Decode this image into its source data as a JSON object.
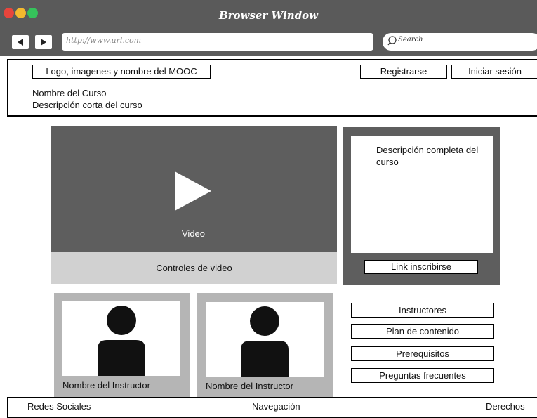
{
  "window": {
    "title": "Browser Window"
  },
  "toolbar": {
    "url": "http://www.url.com",
    "search_placeholder": "Search"
  },
  "header": {
    "logo_label": "Logo, imagenes y nombre del MOOC",
    "register_label": "Registrarse",
    "login_label": "Iniciar sesión",
    "course_name": "Nombre del Curso",
    "course_short_desc": "Descripción corta del curso"
  },
  "video": {
    "label": "Video",
    "controls_label": "Controles de video"
  },
  "description": {
    "text": "Descripción completa del curso",
    "enroll_label": "Link inscribirse"
  },
  "instructors": [
    {
      "name": "Nombre del Instructor"
    },
    {
      "name": "Nombre del Instructor"
    }
  ],
  "side_links": [
    "Instructores",
    "Plan de contenido",
    "Prerequisitos",
    "Preguntas frecuentes"
  ],
  "footer": {
    "social": "Redes Sociales",
    "navigation": "Navegación",
    "rights": "Derechos"
  },
  "colors": {
    "close": "#e8453c",
    "minimize": "#f4b92e",
    "maximize": "#36c25b",
    "chrome": "#5a5a5a",
    "panel": "#5e5e5e"
  }
}
